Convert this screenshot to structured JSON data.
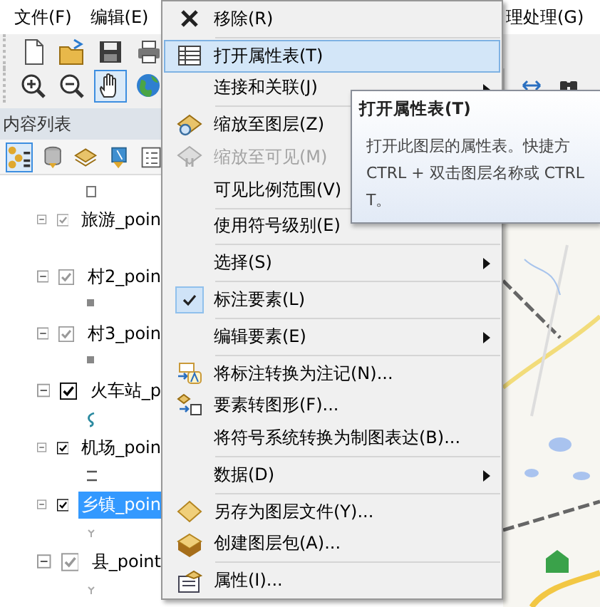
{
  "menubar": {
    "left_items": [
      {
        "label": "文件(F)"
      },
      {
        "label": "编辑(E)"
      }
    ],
    "right_items": [
      {
        "label": "理处理(G)"
      }
    ]
  },
  "table_of_contents": {
    "title": "内容列表",
    "layers": [
      {
        "name": "旅游_poin",
        "checked": true,
        "dimmed": true,
        "selected": false
      },
      {
        "name": "村2_poin",
        "checked": true,
        "dimmed": true,
        "selected": false
      },
      {
        "name": "村3_poin",
        "checked": true,
        "dimmed": true,
        "selected": false
      },
      {
        "name": "火车站_p",
        "checked": true,
        "dimmed": false,
        "selected": false
      },
      {
        "name": "机场_poin",
        "checked": true,
        "dimmed": false,
        "selected": false
      },
      {
        "name": "乡镇_poin",
        "checked": true,
        "dimmed": false,
        "selected": true
      },
      {
        "name": "县_point",
        "checked": true,
        "dimmed": true,
        "selected": false
      }
    ]
  },
  "context_menu": {
    "items": [
      {
        "kind": "item",
        "label": "移除(R)",
        "disabled": false,
        "selected": false,
        "checked": false
      },
      {
        "kind": "separator"
      },
      {
        "kind": "item",
        "label": "打开属性表(T)",
        "disabled": false,
        "selected": true,
        "checked": false
      },
      {
        "kind": "submenu",
        "label": "连接和关联(J)",
        "disabled": false,
        "selected": false,
        "checked": false
      },
      {
        "kind": "separator"
      },
      {
        "kind": "item",
        "label": "缩放至图层(Z)",
        "disabled": false,
        "selected": false,
        "checked": false
      },
      {
        "kind": "item",
        "label": "缩放至可见(M)",
        "disabled": true,
        "selected": false,
        "checked": false
      },
      {
        "kind": "item",
        "label": "可见比例范围(V)",
        "disabled": false,
        "selected": false,
        "checked": false
      },
      {
        "kind": "separator"
      },
      {
        "kind": "item",
        "label": "使用符号级别(E)",
        "disabled": false,
        "selected": false,
        "checked": false
      },
      {
        "kind": "separator"
      },
      {
        "kind": "submenu",
        "label": "选择(S)",
        "disabled": false,
        "selected": false,
        "checked": false
      },
      {
        "kind": "separator"
      },
      {
        "kind": "item",
        "label": "标注要素(L)",
        "disabled": false,
        "selected": false,
        "checked": true
      },
      {
        "kind": "separator"
      },
      {
        "kind": "submenu",
        "label": "编辑要素(E)",
        "disabled": false,
        "selected": false,
        "checked": false
      },
      {
        "kind": "separator"
      },
      {
        "kind": "item",
        "label": "将标注转换为注记(N)...",
        "disabled": false,
        "selected": false,
        "checked": false
      },
      {
        "kind": "item",
        "label": "要素转图形(F)...",
        "disabled": false,
        "selected": false,
        "checked": false
      },
      {
        "kind": "item",
        "label": "将符号系统转换为制图表达(B)...",
        "disabled": false,
        "selected": false,
        "checked": false
      },
      {
        "kind": "separator"
      },
      {
        "kind": "submenu",
        "label": "数据(D)",
        "disabled": false,
        "selected": false,
        "checked": false
      },
      {
        "kind": "separator"
      },
      {
        "kind": "item",
        "label": "另存为图层文件(Y)...",
        "disabled": false,
        "selected": false,
        "checked": false
      },
      {
        "kind": "item",
        "label": "创建图层包(A)...",
        "disabled": false,
        "selected": false,
        "checked": false
      },
      {
        "kind": "separator"
      },
      {
        "kind": "item",
        "label": "属性(I)...",
        "disabled": false,
        "selected": false,
        "checked": false
      }
    ]
  },
  "tooltip": {
    "title": "打开属性表(T)",
    "lines": [
      "打开此图层的属性表。快捷方",
      "CTRL + 双击图层名称或 CTRL",
      "T。"
    ]
  }
}
